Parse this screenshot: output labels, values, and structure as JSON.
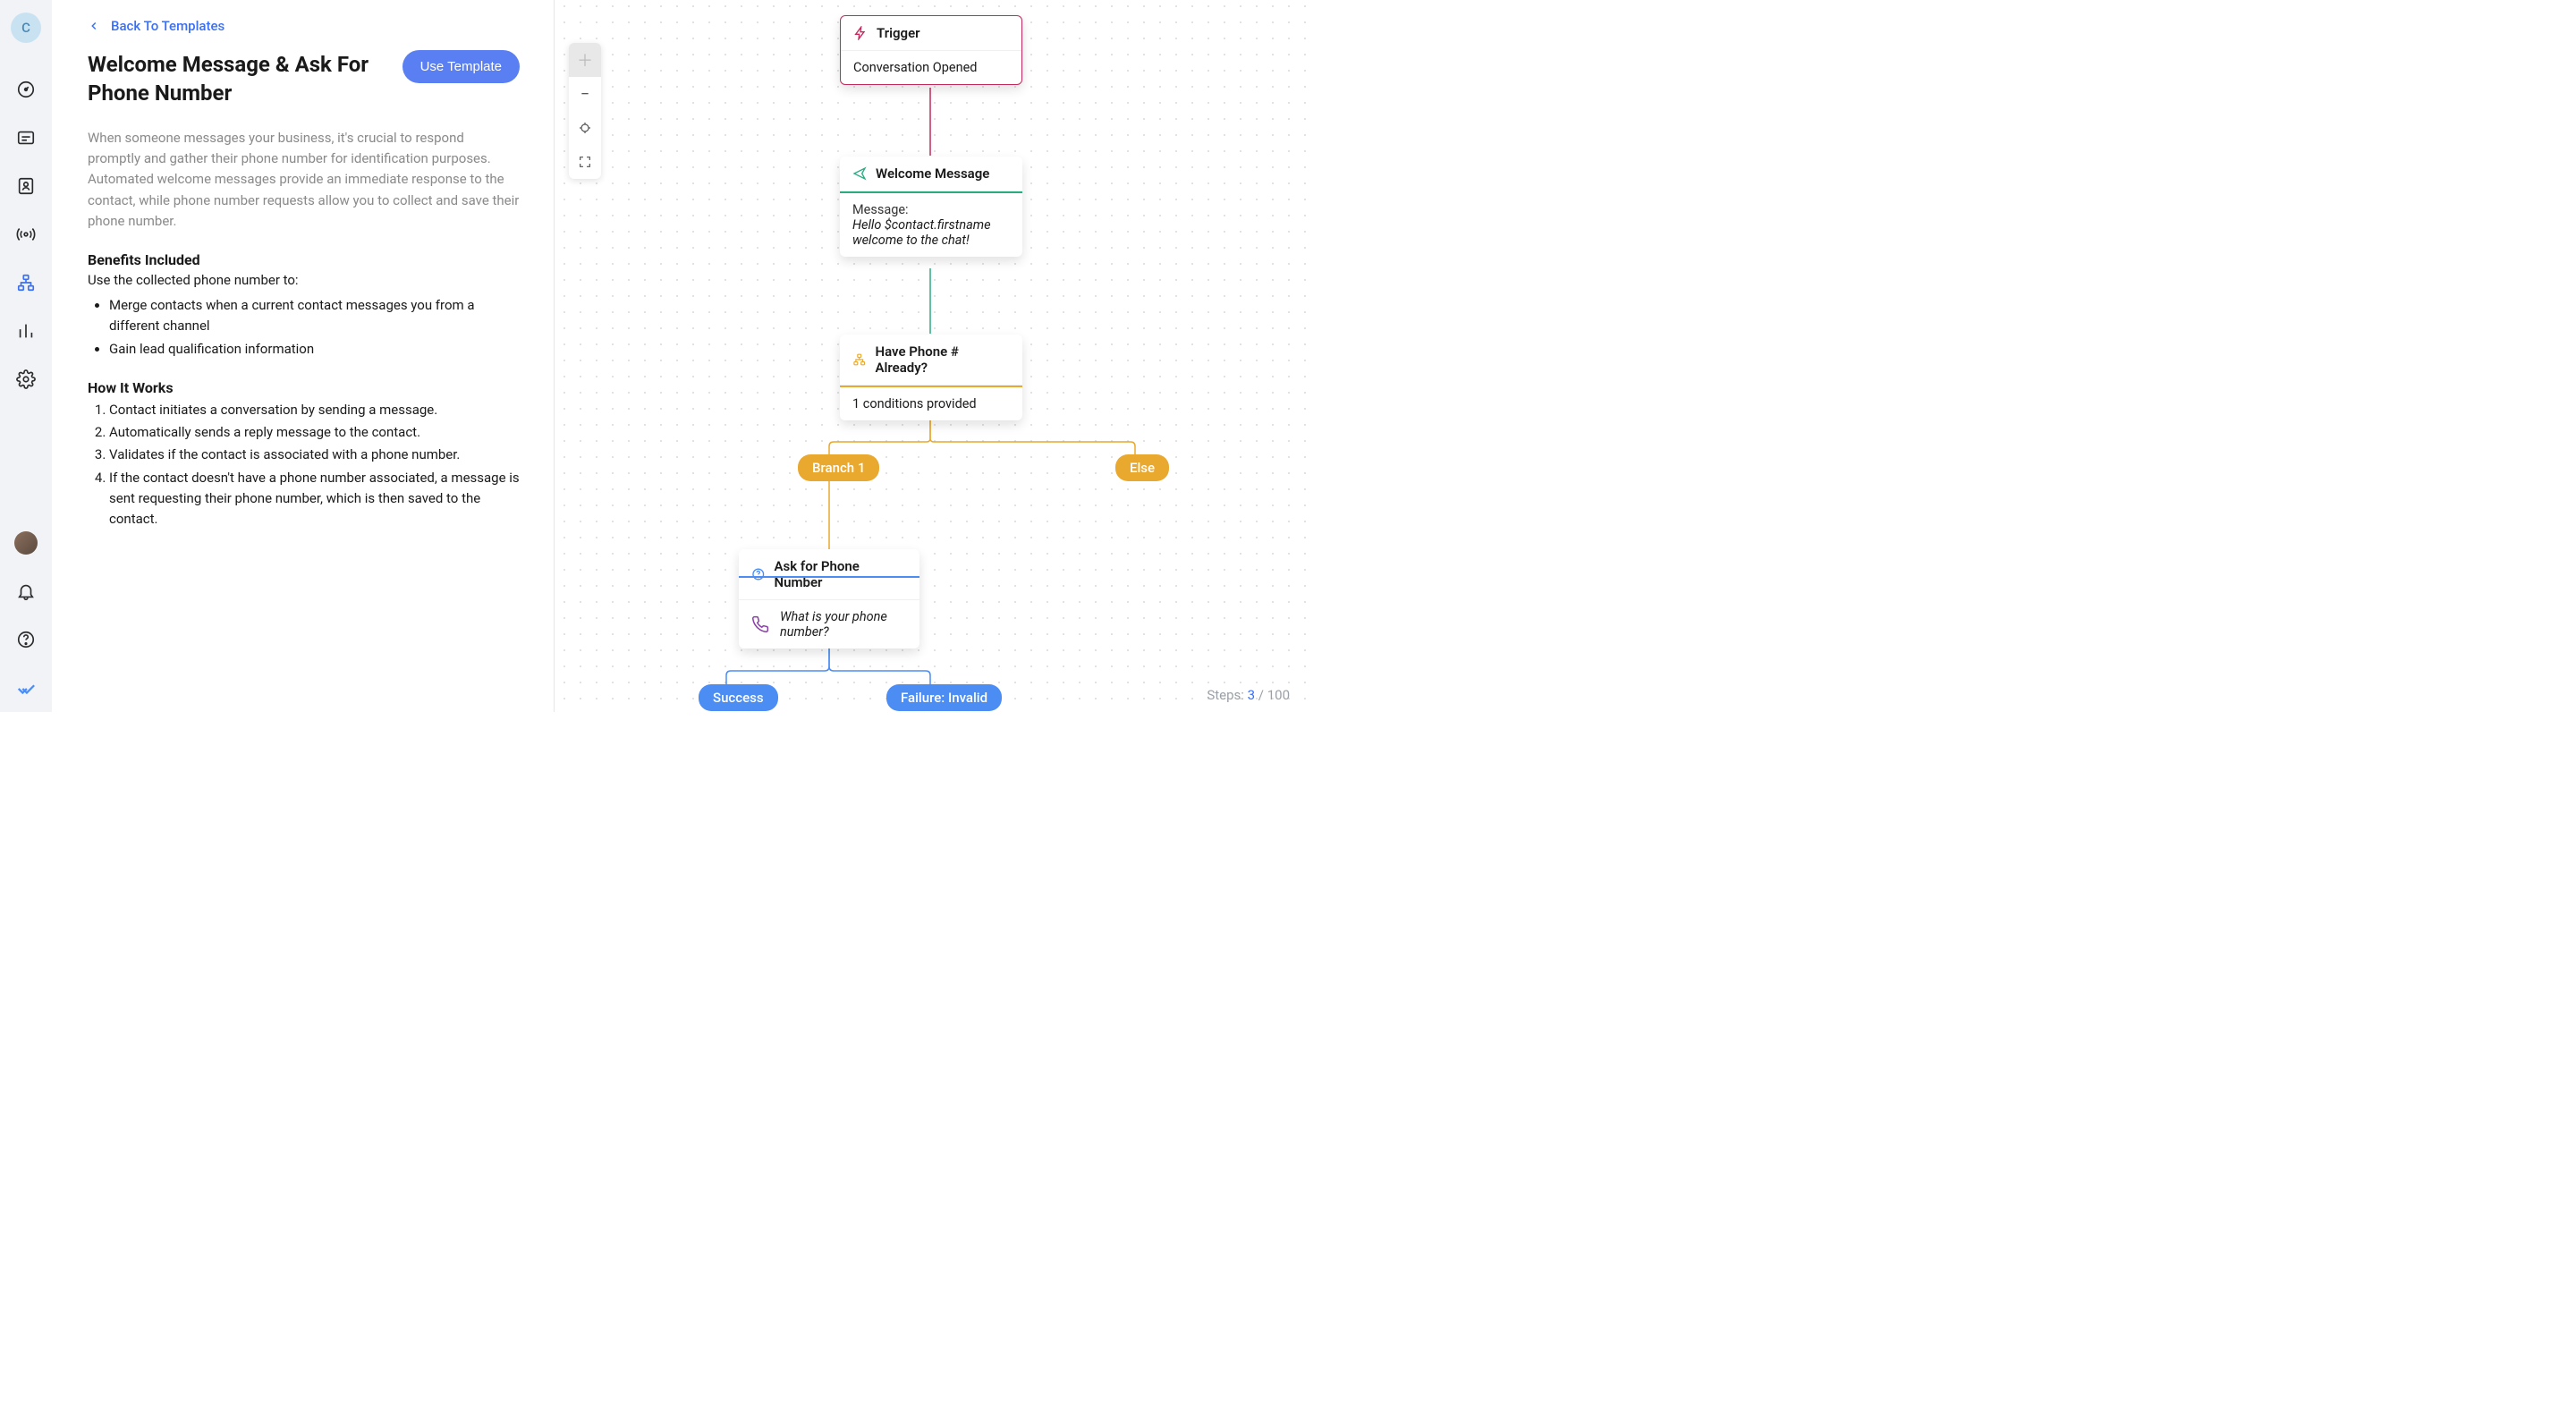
{
  "sidebar": {
    "avatar_letter": "C"
  },
  "content": {
    "back_label": "Back To Templates",
    "title": "Welcome Message & Ask For Phone Number",
    "use_template_label": "Use Template",
    "description": "When someone messages your business, it's crucial to respond promptly and gather their phone number for identification purposes. Automated welcome messages provide an immediate response to the contact, while phone number requests allow you to collect and save their phone number.",
    "benefits_heading": "Benefits Included",
    "benefits_sub": "Use the collected phone number to:",
    "benefits_items": [
      "Merge contacts when a current contact messages you from a different channel",
      "Gain lead qualification information"
    ],
    "how_heading": "How It Works",
    "how_items": [
      "Contact initiates a conversation by sending a message.",
      "Automatically sends a reply message to the contact.",
      "Validates if the contact is associated with a phone number.",
      "If the contact doesn't have a phone number associated, a message is sent requesting their phone number, which is then saved to the contact."
    ]
  },
  "flow": {
    "trigger": {
      "title": "Trigger",
      "body": "Conversation Opened"
    },
    "welcome": {
      "title": "Welcome Message",
      "body_label": "Message:",
      "body_msg": "Hello $contact.firstname welcome to the chat!"
    },
    "have_phone": {
      "title": "Have Phone # Already?",
      "body": "1 conditions provided"
    },
    "branch1": "Branch 1",
    "else": "Else",
    "ask": {
      "title": "Ask for Phone Number",
      "body": "What is your phone number?"
    },
    "success": "Success",
    "failure": "Failure: Invalid"
  },
  "steps": {
    "label": "Steps:",
    "current": "3",
    "sep": " / ",
    "max": "100"
  },
  "colors": {
    "trigger": "#c12a5e",
    "welcome": "#2bab82",
    "branch": "#e9a82e",
    "ask": "#4b8df2",
    "phone_icon": "#8b3fa8"
  }
}
